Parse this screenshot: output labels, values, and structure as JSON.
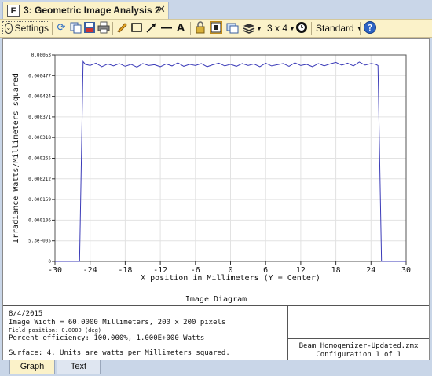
{
  "window": {
    "tab_title": "3: Geometric Image Analysis 2",
    "tab_icon_letter": "F",
    "close_glyph": "✕"
  },
  "toolbar": {
    "settings_label": "Settings",
    "grid_label": "3 x 4",
    "style_label": "Standard",
    "icons": [
      "refresh-icon",
      "copy-icon",
      "save-icon",
      "print-icon",
      "pencil-icon",
      "rectangle-icon",
      "arrow-icon",
      "line-icon",
      "text-icon",
      "lock-icon",
      "fit-icon",
      "window-icon",
      "layers-icon",
      "grid-icon",
      "clock-icon",
      "help-icon"
    ]
  },
  "chart_data": {
    "type": "line",
    "xlabel": "X position in Millimeters (Y = Center)",
    "ylabel": "Irradiance Watts/Millimeters squared",
    "xlim": [
      -30,
      30
    ],
    "ylim": [
      0,
      0.00053
    ],
    "x_ticks": [
      "-30",
      "-24",
      "-18",
      "-12",
      "-6",
      "0",
      "6",
      "12",
      "18",
      "24",
      "30"
    ],
    "y_ticks": [
      "0",
      "5.3e-005",
      "0.000106",
      "0.000159",
      "0.000212",
      "0.000265",
      "0.000318",
      "0.000371",
      "0.000424",
      "0.000477",
      "0.00053"
    ],
    "grid": true,
    "series": [
      {
        "color": "#3b3bb8",
        "x": [
          -30,
          -25.8,
          -25.2,
          -24.8,
          -24.0,
          -23.0,
          -22.0,
          -21.0,
          -20.0,
          -19.0,
          -18.0,
          -17.0,
          -16.0,
          -15.0,
          -14.0,
          -13.0,
          -12.0,
          -11.0,
          -10.0,
          -9.0,
          -8.0,
          -7.0,
          -6.0,
          -5.0,
          -4.0,
          -3.0,
          -2.0,
          -1.0,
          0,
          1.0,
          2.0,
          3.0,
          4.0,
          5.0,
          6.0,
          7.0,
          8.0,
          9.0,
          10.0,
          11.0,
          12.0,
          13.0,
          14.0,
          15.0,
          16.0,
          17.0,
          18.0,
          19.0,
          20.0,
          21.0,
          22.0,
          23.0,
          24.0,
          24.8,
          25.2,
          25.8,
          30
        ],
        "y": [
          0,
          0,
          0.000513,
          0.000506,
          0.000503,
          0.000509,
          0.0005,
          0.000507,
          0.000502,
          0.000508,
          0.000501,
          0.000506,
          0.000499,
          0.000508,
          0.000503,
          0.000505,
          0.0005,
          0.000507,
          0.000502,
          0.00051,
          0.000501,
          0.000506,
          0.000503,
          0.000508,
          0.0005,
          0.000505,
          0.000509,
          0.000502,
          0.000506,
          0.000501,
          0.000508,
          0.000503,
          0.000507,
          0.0005,
          0.000509,
          0.000502,
          0.000505,
          0.000508,
          0.000501,
          0.00051,
          0.000503,
          0.000506,
          0.0005,
          0.000508,
          0.000502,
          0.000507,
          0.000511,
          0.000504,
          0.000509,
          0.000502,
          0.000512,
          0.000504,
          0.000508,
          0.000506,
          0.000503,
          0,
          0
        ]
      }
    ]
  },
  "diagram": {
    "caption": "Image Diagram",
    "date": "8/4/2015",
    "image_width": "Image Width = 60.0000 Millimeters, 200 x 200 pixels",
    "field_position": "Field position:      0.0000 (deg)",
    "efficiency": "Percent efficiency: 100.000%, 1.000E+000 Watts",
    "surface": "Surface: 4. Units are watts per Millimeters squared.",
    "file_name": "Beam Homogenizer-Updated.zmx",
    "configuration": "Configuration 1 of 1"
  },
  "bottom_tabs": {
    "graph": "Graph",
    "text": "Text"
  }
}
